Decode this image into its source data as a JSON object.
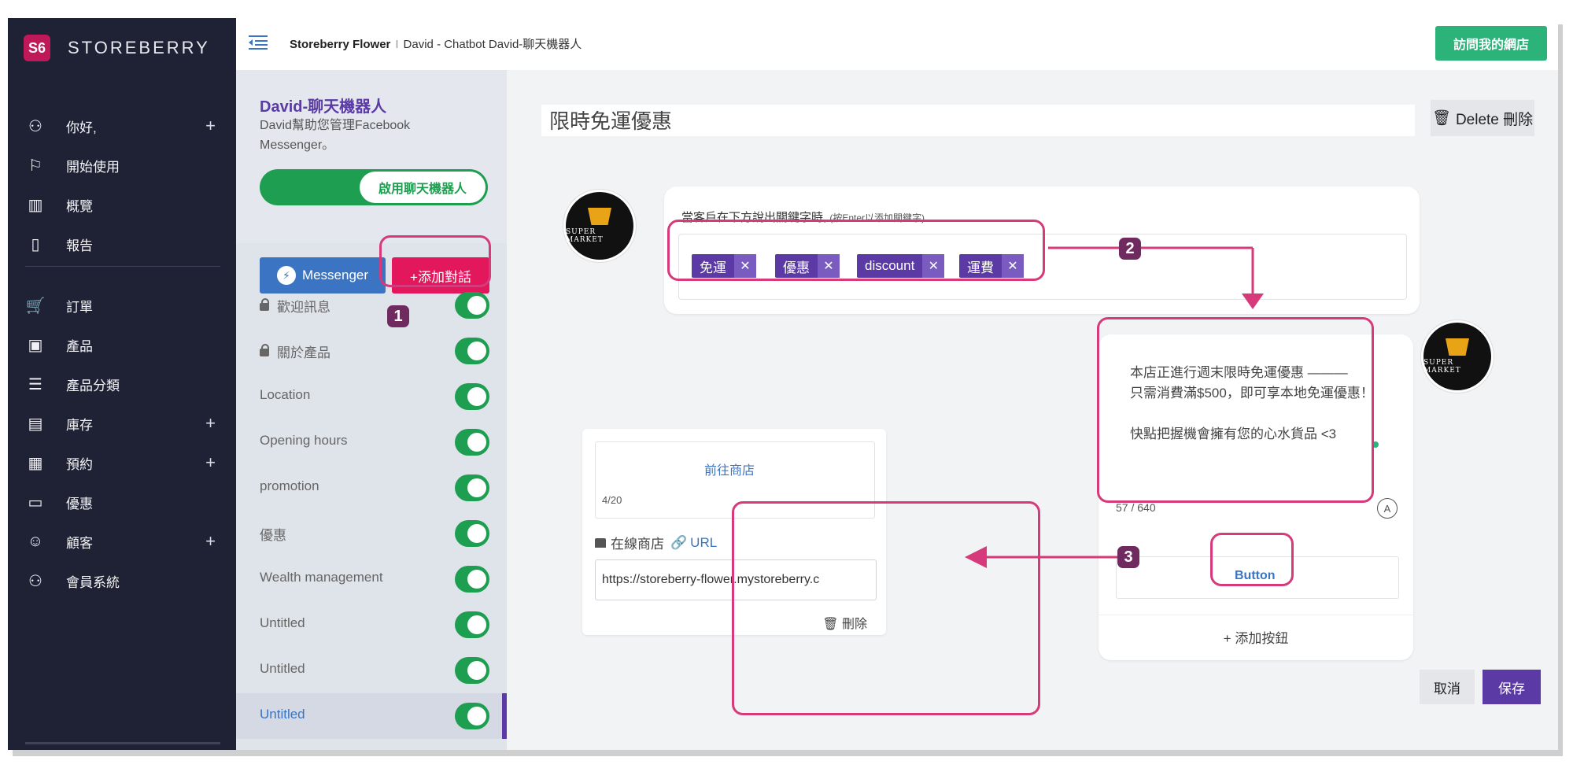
{
  "brand": {
    "logo_text": "S6",
    "name": "STOREBERRY"
  },
  "sidebar": {
    "items": [
      {
        "icon": "user-icon",
        "glyph": "⚇",
        "label": "你好,",
        "plus": "+"
      },
      {
        "icon": "flag-icon",
        "glyph": "⚐",
        "label": "開始使用",
        "plus": ""
      },
      {
        "icon": "chart-icon",
        "glyph": "▥",
        "label": "概覽",
        "plus": ""
      },
      {
        "icon": "file-icon",
        "glyph": "▯",
        "label": "報告",
        "plus": ""
      },
      {
        "icon": "cart-icon",
        "glyph": "🛒",
        "label": "訂單",
        "plus": ""
      },
      {
        "icon": "product-icon",
        "glyph": "▣",
        "label": "產品",
        "plus": ""
      },
      {
        "icon": "list-icon",
        "glyph": "☰",
        "label": "產品分類",
        "plus": ""
      },
      {
        "icon": "inventory-icon",
        "glyph": "▤",
        "label": "庫存",
        "plus": "+"
      },
      {
        "icon": "calendar-icon",
        "glyph": "▦",
        "label": "預約",
        "plus": "+"
      },
      {
        "icon": "ticket-icon",
        "glyph": "▭",
        "label": "優惠",
        "plus": ""
      },
      {
        "icon": "customer-icon",
        "glyph": "☺",
        "label": "顧客",
        "plus": "+"
      },
      {
        "icon": "member-icon",
        "glyph": "⚇",
        "label": "會員系統",
        "plus": ""
      }
    ]
  },
  "topbar": {
    "store": "Storeberry Flower",
    "separator": "I",
    "path": "David - Chatbot David-聊天機器人",
    "visit_button": "訪問我的網店"
  },
  "panel": {
    "bot_title": "David-聊天機器人",
    "bot_desc": "David幫助您管理Facebook Messenger。",
    "enable_label": "啟用聊天機器人",
    "messenger_tab": "Messenger",
    "add_conversation": "+添加對話",
    "conversations": [
      {
        "label": "歡迎訊息",
        "locked": true
      },
      {
        "label": "關於產品",
        "locked": true
      },
      {
        "label": "Location",
        "locked": false
      },
      {
        "label": "Opening hours",
        "locked": false
      },
      {
        "label": "promotion",
        "locked": false
      },
      {
        "label": "優惠",
        "locked": false
      },
      {
        "label": "Wealth management",
        "locked": false
      },
      {
        "label": "Untitled",
        "locked": false
      },
      {
        "label": "Untitled",
        "locked": false
      },
      {
        "label": "Untitled",
        "locked": false
      }
    ]
  },
  "main": {
    "title": "限時免運優惠",
    "delete_button": "Delete 刪除",
    "keyword_hint": "當客戶在下方說出關鍵字時,",
    "keyword_hint_small": "(按Enter以添加關鍵字)",
    "keywords": [
      "免運",
      "優惠",
      "discount",
      "運費"
    ],
    "chip_remove": "✕",
    "avatar_label": "SUPER MARKET",
    "message_text": "本店正進行週末限時免運優惠 ———\n只需消費滿$500，即可享本地免運優惠！\n\n快點把握機會擁有您的心水貨品 <3",
    "message_counter": "57 / 640",
    "a_badge": "A",
    "button_label": "Button",
    "add_button": "+ 添加按鈕",
    "link_title": "前往商店",
    "link_counter": "4/20",
    "url_label": "在線商店",
    "url_link_text": "URL",
    "url_value": "https://storeberry-flower.mystoreberry.c",
    "link_delete": "刪除",
    "cancel": "取消",
    "save": "保存"
  },
  "annotations": {
    "n1": "1",
    "n2": "2",
    "n3": "3"
  },
  "colors": {
    "accent": "#5b3aa5",
    "brand": "#c0195a",
    "success": "#2cb37a",
    "highlight": "#d63a7a",
    "sidebar": "#1f2235"
  }
}
